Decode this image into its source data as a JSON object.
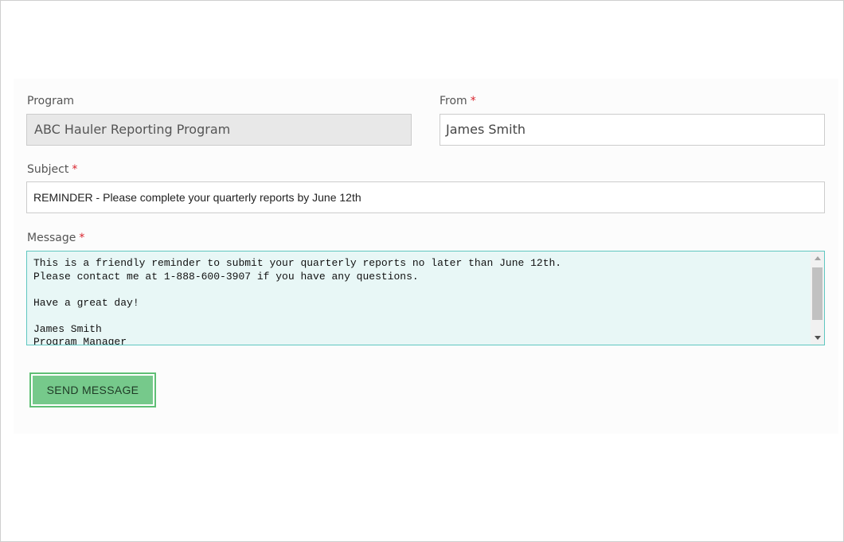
{
  "form": {
    "program": {
      "label": "Program",
      "value": "ABC Hauler Reporting Program"
    },
    "from": {
      "label": "From",
      "required_mark": "*",
      "value": "James Smith"
    },
    "subject": {
      "label": "Subject",
      "required_mark": "*",
      "value": "REMINDER - Please complete your quarterly reports by June 12th"
    },
    "message": {
      "label": "Message",
      "required_mark": "*",
      "value": "This is a friendly reminder to submit your quarterly reports no later than June 12th.\nPlease contact me at 1-888-600-3907 if you have any questions.\n\nHave a great day!\n\nJames Smith\nProgram Manager"
    },
    "send_label": "SEND MESSAGE"
  },
  "colors": {
    "accent_button": "#76c98b",
    "textarea_focus_border": "#5fc7c0",
    "textarea_bg": "#e8f7f6",
    "required": "#d9232d",
    "disabled_field_bg": "#e8e8e8"
  },
  "icons": {
    "scroll_up": "scroll-up-arrow-icon",
    "scroll_down": "scroll-down-arrow-icon"
  }
}
